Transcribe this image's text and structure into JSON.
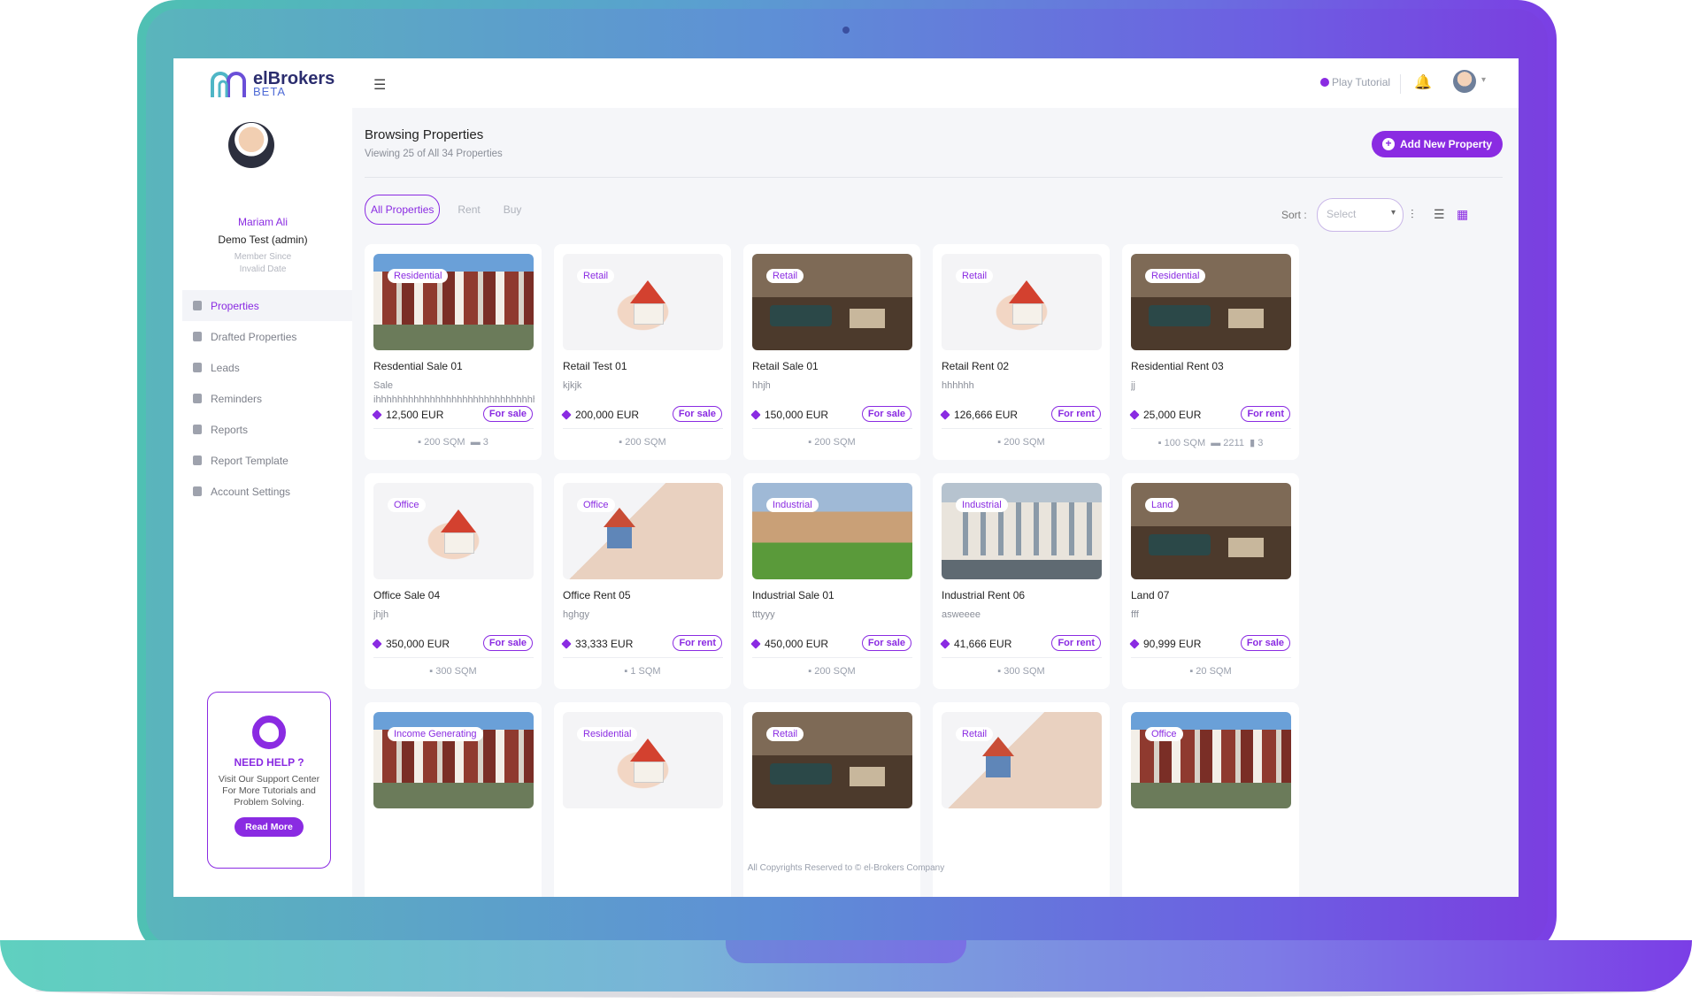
{
  "app": {
    "logo_name": "elBrokers",
    "logo_badge": "BETA",
    "accent": "#8a2be2"
  },
  "topbar": {
    "tutorial": "Play Tutorial"
  },
  "profile": {
    "name": "Mariam Ali",
    "role": "Demo Test (admin)",
    "member_since": "Member Since",
    "since_value": "Invalid Date"
  },
  "nav": [
    {
      "label": "Properties",
      "icon": "home-icon",
      "active": true
    },
    {
      "label": "Drafted Properties",
      "icon": "clipboard-icon"
    },
    {
      "label": "Leads",
      "icon": "user-icon"
    },
    {
      "label": "Reminders",
      "icon": "calendar-icon"
    },
    {
      "label": "Reports",
      "icon": "report-icon"
    },
    {
      "label": "Report Template",
      "icon": "grid-icon"
    },
    {
      "label": "Account Settings",
      "icon": "gear-icon"
    }
  ],
  "help": {
    "title": "NEED HELP ?",
    "text": "Visit Our Support Center For More Tutorials and Problem Solving.",
    "button": "Read More"
  },
  "page": {
    "title": "Browsing Properties",
    "subtitle": "Viewing 25 of All 34 Properties",
    "add_button": "Add New Property"
  },
  "tabs": [
    "All Properties",
    "Rent",
    "Buy"
  ],
  "sort": {
    "label": "Sort :",
    "placeholder": "Select"
  },
  "cards": [
    {
      "tag": "Residential",
      "title": "Resdential Sale 01",
      "desc": "Sale",
      "desc2": "ihhhhhhhhhhhhhhhhhhhhhhhhhhhhhhhhhh",
      "price": "12,500 EUR",
      "status": "For sale",
      "meta": "200 SQM",
      "meta2": "3",
      "img": "street"
    },
    {
      "tag": "Retail",
      "title": "Retail Test 01",
      "desc": "kjkjk",
      "price": "200,000 EUR",
      "status": "For sale",
      "meta": "200 SQM",
      "img": "hands"
    },
    {
      "tag": "Retail",
      "title": "Retail Sale 01",
      "desc": "hhjh",
      "price": "150,000 EUR",
      "status": "For sale",
      "meta": "200 SQM",
      "img": "room"
    },
    {
      "tag": "Retail",
      "title": "Retail Rent 02",
      "desc": "hhhhhh",
      "price": "126,666 EUR",
      "status": "For rent",
      "meta": "200 SQM",
      "img": "hands"
    },
    {
      "tag": "Residential",
      "title": "Residential Rent 03",
      "desc": "jj",
      "price": "25,000 EUR",
      "status": "For rent",
      "meta": "100 SQM",
      "meta2": "2211",
      "meta3": "3",
      "img": "room"
    },
    {
      "tag": "Office",
      "title": "Office Sale 04",
      "desc": "jhjh",
      "price": "350,000 EUR",
      "status": "For sale",
      "meta": "300 SQM",
      "img": "hands"
    },
    {
      "tag": "Office",
      "title": "Office Rent 05",
      "desc": "hghgy",
      "price": "33,333 EUR",
      "status": "For rent",
      "meta": "1 SQM",
      "img": "keys"
    },
    {
      "tag": "Industrial",
      "title": "Industrial Sale 01",
      "desc": "tttyyy",
      "price": "450,000 EUR",
      "status": "For sale",
      "meta": "200 SQM",
      "img": "villa"
    },
    {
      "tag": "Industrial",
      "title": "Industrial Rent 06",
      "desc": "asweeee",
      "price": "41,666 EUR",
      "status": "For rent",
      "meta": "300 SQM",
      "img": "bldg"
    },
    {
      "tag": "Land",
      "title": "Land 07",
      "desc": "fff",
      "price": "90,999 EUR",
      "status": "For sale",
      "meta": "20 SQM",
      "img": "room"
    },
    {
      "tag": "Income Generating",
      "img": "street"
    },
    {
      "tag": "Residential",
      "img": "hands"
    },
    {
      "tag": "Retail",
      "img": "room"
    },
    {
      "tag": "Retail",
      "img": "keys"
    },
    {
      "tag": "Office",
      "img": "street"
    }
  ],
  "footer": "All Copyrights Reserved to © el-Brokers Company"
}
